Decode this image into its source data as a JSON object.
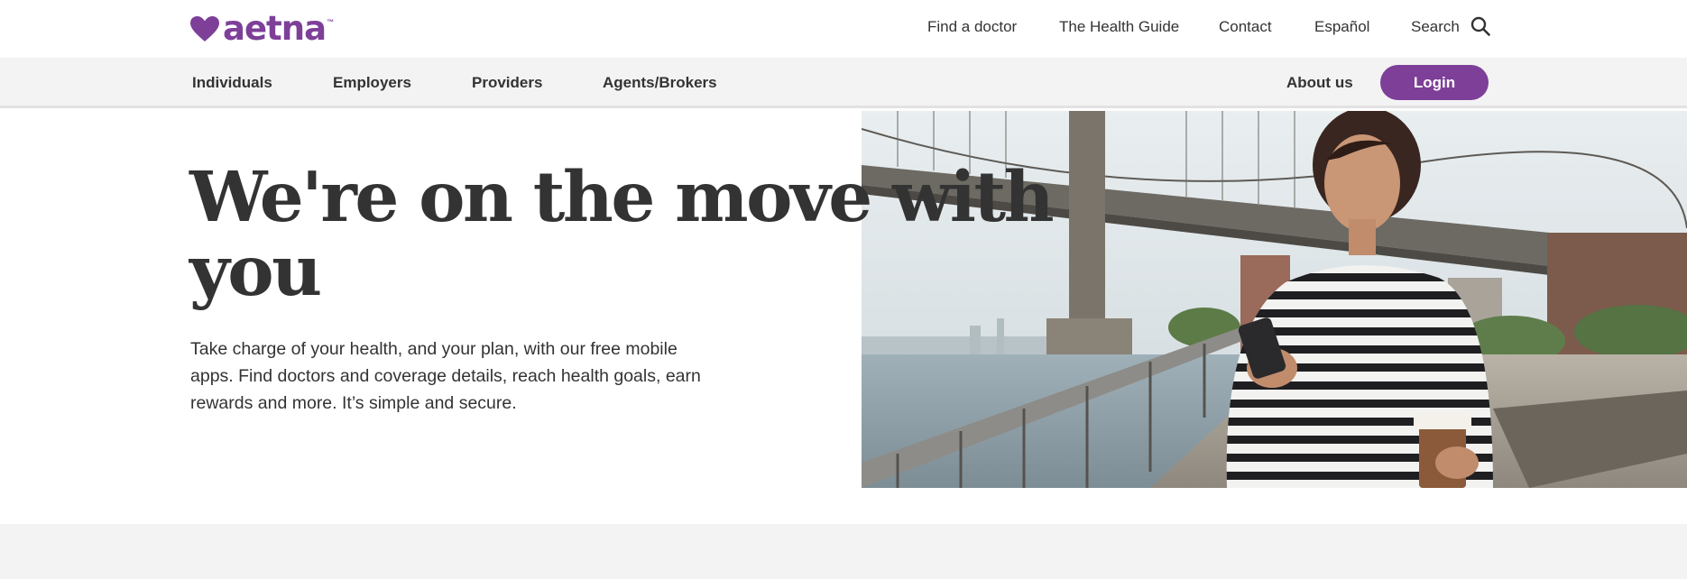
{
  "brand": {
    "name": "aetna",
    "tm": "™",
    "color": "#7d3f98"
  },
  "utility_nav": {
    "links": [
      "Find a doctor",
      "The Health Guide",
      "Contact",
      "Español",
      "Search"
    ],
    "search_icon": "search-icon"
  },
  "main_nav": {
    "items": [
      "Individuals",
      "Employers",
      "Providers",
      "Agents/Brokers"
    ],
    "about": "About us",
    "login": "Login"
  },
  "hero": {
    "title": "We're on the move with you",
    "body": "Take charge of your health, and your plan, with our free mobile apps. Find doctors and coverage details, reach health goals, earn rewards and more. It’s simple and secure."
  },
  "colors": {
    "accent": "#7d3f98",
    "text": "#333333",
    "nav_bg": "#f3f3f3"
  }
}
